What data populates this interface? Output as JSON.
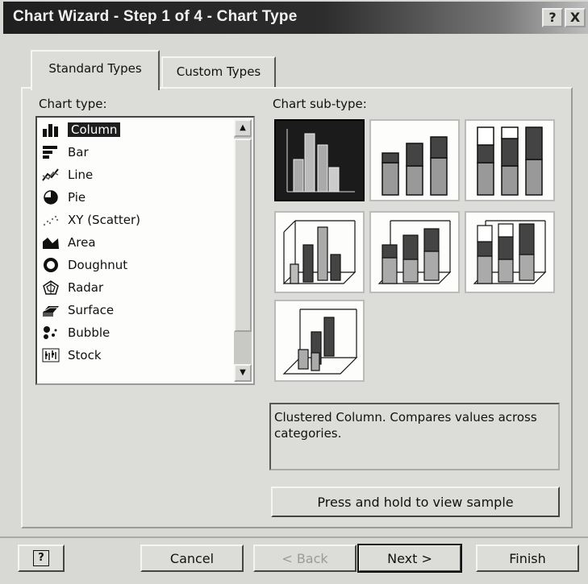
{
  "window": {
    "title": "Chart Wizard - Step 1 of 4 - Chart Type",
    "help_glyph": "?",
    "close_glyph": "X"
  },
  "tabs": [
    {
      "label": "Standard Types",
      "active": true
    },
    {
      "label": "Custom Types",
      "active": false
    }
  ],
  "chart_type": {
    "label": "Chart type:",
    "items": [
      {
        "label": "Column",
        "icon": "column-chart-icon",
        "selected": true
      },
      {
        "label": "Bar",
        "icon": "bar-chart-icon"
      },
      {
        "label": "Line",
        "icon": "line-chart-icon"
      },
      {
        "label": "Pie",
        "icon": "pie-chart-icon"
      },
      {
        "label": "XY (Scatter)",
        "icon": "scatter-chart-icon"
      },
      {
        "label": "Area",
        "icon": "area-chart-icon"
      },
      {
        "label": "Doughnut",
        "icon": "doughnut-chart-icon"
      },
      {
        "label": "Radar",
        "icon": "radar-chart-icon"
      },
      {
        "label": "Surface",
        "icon": "surface-chart-icon"
      },
      {
        "label": "Bubble",
        "icon": "bubble-chart-icon"
      },
      {
        "label": "Stock",
        "icon": "stock-chart-icon"
      }
    ]
  },
  "sub_type": {
    "label": "Chart sub-type:",
    "selected_index": 0,
    "thumbnails": [
      "clustered-column-icon",
      "stacked-column-icon",
      "100-stacked-column-icon",
      "3d-clustered-column-icon",
      "3d-stacked-column-icon",
      "3d-100-stacked-column-icon",
      "3d-column-icon"
    ]
  },
  "description": "Clustered Column. Compares values across categories.",
  "sample_button": "Press and hold to view sample",
  "footer": {
    "help": "?",
    "cancel": "Cancel",
    "back": "< Back",
    "next": "Next >",
    "finish": "Finish"
  },
  "colors": {
    "selection": "#1e1e1e",
    "face": "#dcdcd8",
    "title_bar": "#2a2a2a"
  }
}
